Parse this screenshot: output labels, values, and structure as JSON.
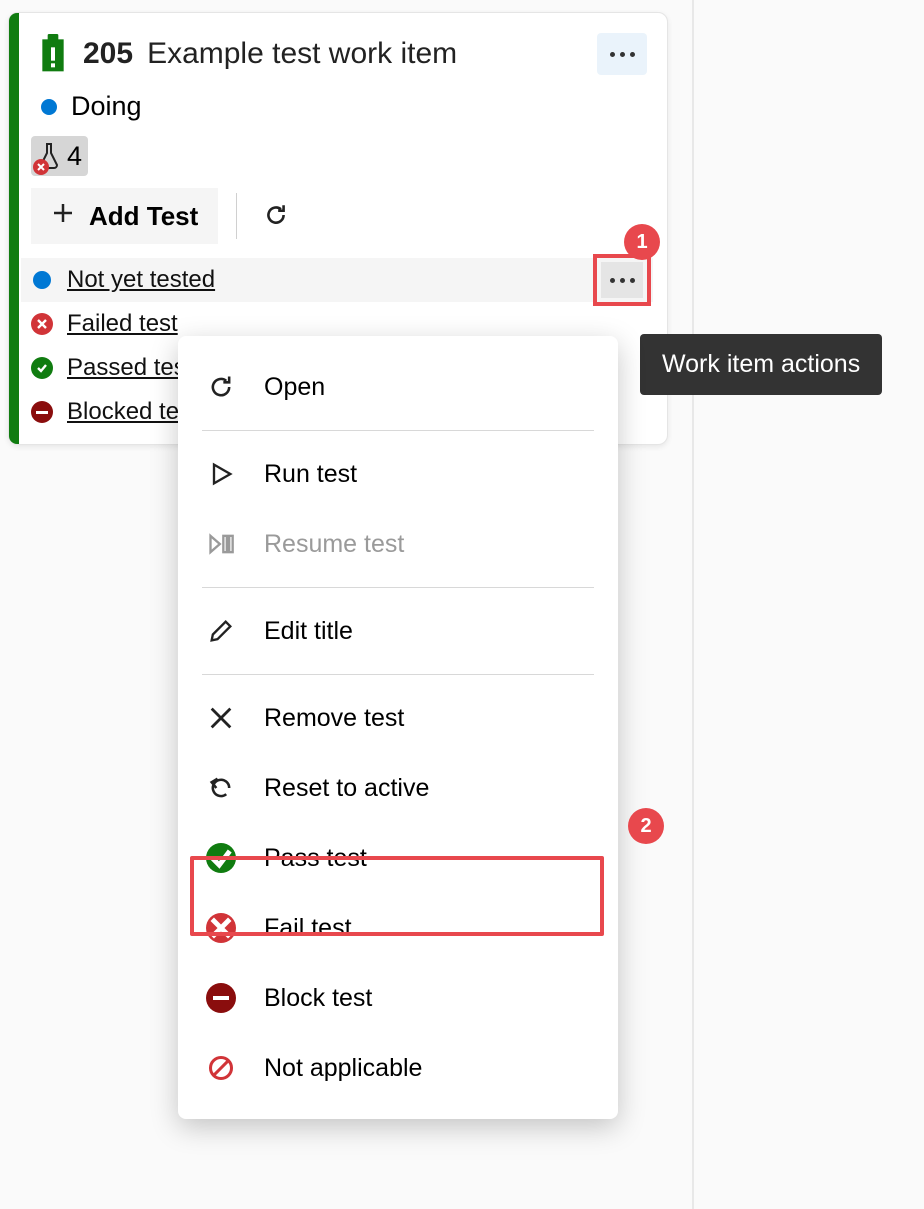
{
  "card": {
    "id": "205",
    "title": "Example test work item",
    "state": "Doing",
    "flask_count": "4",
    "add_test_label": "Add Test"
  },
  "tests": [
    {
      "status": "active",
      "label": "Not yet tested",
      "selected": true
    },
    {
      "status": "failed",
      "label": "Failed test"
    },
    {
      "status": "passed",
      "label": "Passed test"
    },
    {
      "status": "blocked",
      "label": "Blocked test"
    }
  ],
  "tooltip": "Work item actions",
  "menu": {
    "open": "Open",
    "run": "Run test",
    "resume": "Resume test",
    "edit": "Edit title",
    "remove": "Remove test",
    "reset": "Reset to active",
    "pass": "Pass test",
    "fail": "Fail test",
    "block": "Block test",
    "na": "Not applicable"
  },
  "callouts": {
    "one": "1",
    "two": "2"
  }
}
